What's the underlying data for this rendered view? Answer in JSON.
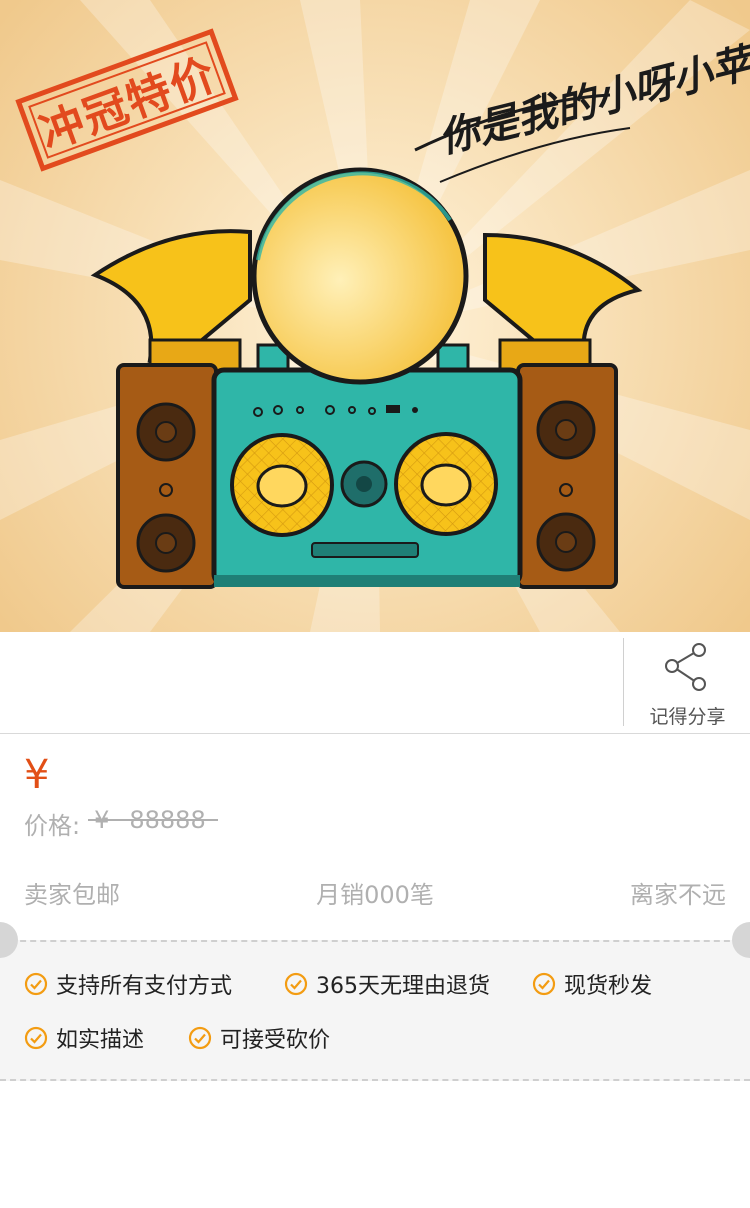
{
  "hero": {
    "stamp_text": "冲冠特价",
    "slogan": "你是我的小呀小苹果",
    "colors": {
      "background": "#f2cf95",
      "stamp": "#e24a1e",
      "speaker_body": "#2fb6a8",
      "horn": "#f7c21a",
      "cabinet": "#a65b15"
    }
  },
  "share": {
    "label": "记得分享",
    "icon": "share-icon"
  },
  "price": {
    "currency": "¥",
    "old_label": "价格:",
    "old_currency": "¥",
    "old_value": "88888"
  },
  "meta": {
    "shipping": "卖家包邮",
    "monthly_sales": "月销000笔",
    "distance": "离家不远"
  },
  "services": [
    {
      "label": "支持所有支付方式",
      "icon": "check-circle-icon"
    },
    {
      "label": "365天无理由退货",
      "icon": "check-circle-icon"
    },
    {
      "label": "现货秒发",
      "icon": "check-circle-icon"
    },
    {
      "label": "如实描述",
      "icon": "check-circle-icon"
    },
    {
      "label": "可接受砍价",
      "icon": "check-circle-icon"
    }
  ],
  "accent_color": "#e24f16",
  "check_color": "#f39c12"
}
